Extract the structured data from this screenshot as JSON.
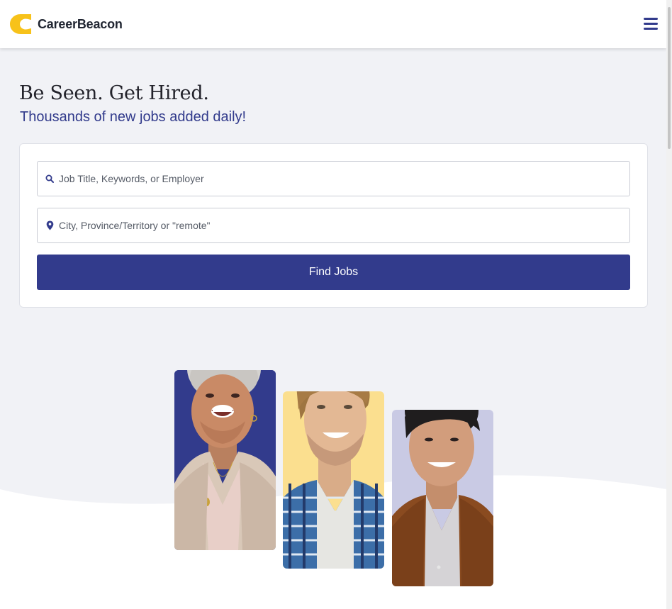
{
  "header": {
    "brand_name": "CareerBeacon",
    "logo_icon": "careerbeacon-logo-icon",
    "menu_icon": "hamburger-menu-icon"
  },
  "hero": {
    "headline": "Be Seen. Get Hired.",
    "subheadline": "Thousands of new jobs added daily!"
  },
  "search": {
    "keywords_placeholder": "Job Title, Keywords, or Employer",
    "keywords_icon": "search-icon",
    "location_placeholder": "City, Province/Territory or \"remote\"",
    "location_icon": "map-pin-icon",
    "submit_label": "Find Jobs"
  },
  "colors": {
    "brand_navy": "#323b8c",
    "brand_yellow": "#f7c21a",
    "page_background": "#f1f2f6"
  }
}
